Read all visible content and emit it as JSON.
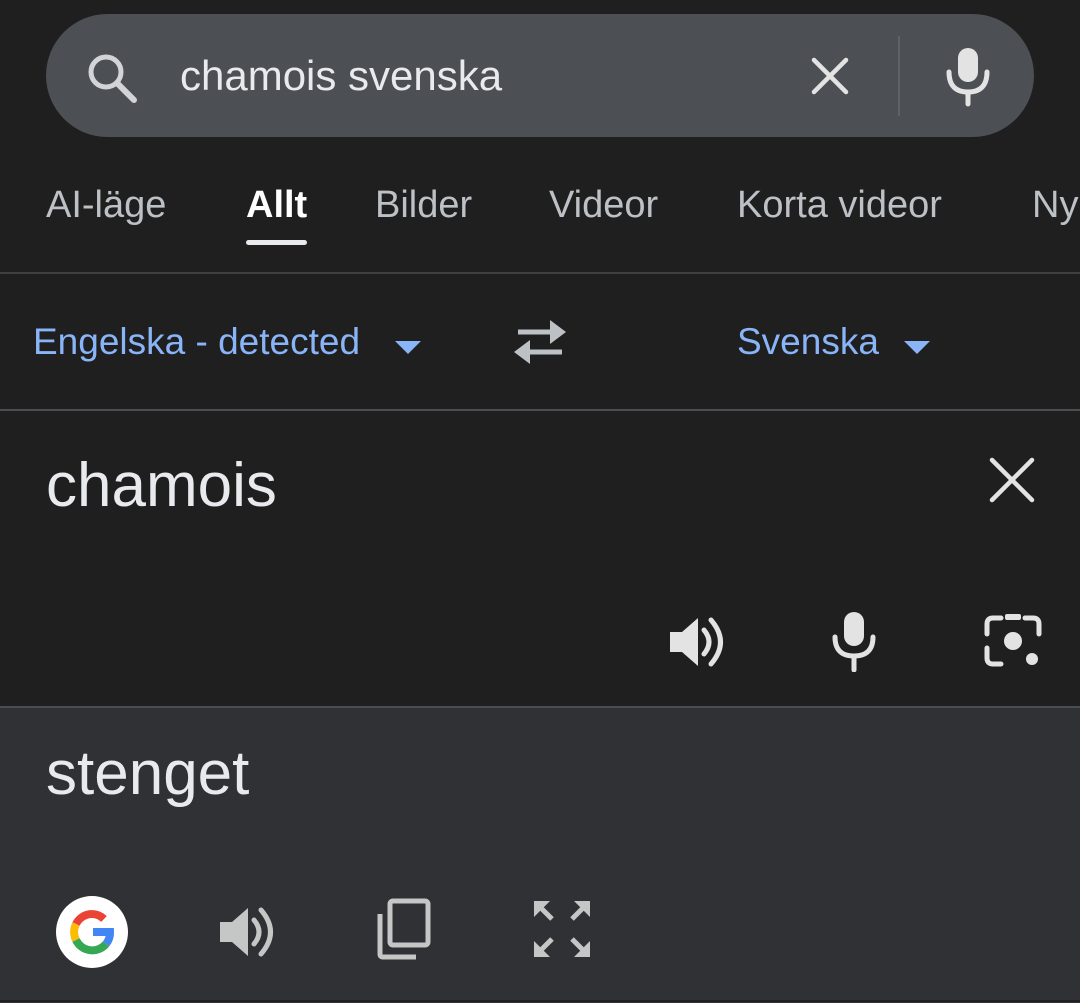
{
  "search": {
    "query": "chamois svenska"
  },
  "tabs": [
    {
      "label": "AI-läge"
    },
    {
      "label": "Allt"
    },
    {
      "label": "Bilder"
    },
    {
      "label": "Videor"
    },
    {
      "label": "Korta videor"
    },
    {
      "label": "Ny"
    }
  ],
  "translate": {
    "source_language": "Engelska - detected",
    "target_language": "Svenska",
    "source_text": "chamois",
    "translated_text": "stenget"
  },
  "colors": {
    "accent": "#8ab4f8",
    "background": "#1f1f1f",
    "search_bar": "#4c4f53",
    "result_panel": "#303134"
  },
  "icons": {
    "search": "search-icon",
    "clear": "close-icon",
    "mic": "mic-icon",
    "swap": "swap-languages-icon",
    "speaker": "speaker-icon",
    "camera": "camera-icon",
    "google": "google-logo-icon",
    "copy": "copy-icon",
    "fullscreen": "fullscreen-icon"
  }
}
